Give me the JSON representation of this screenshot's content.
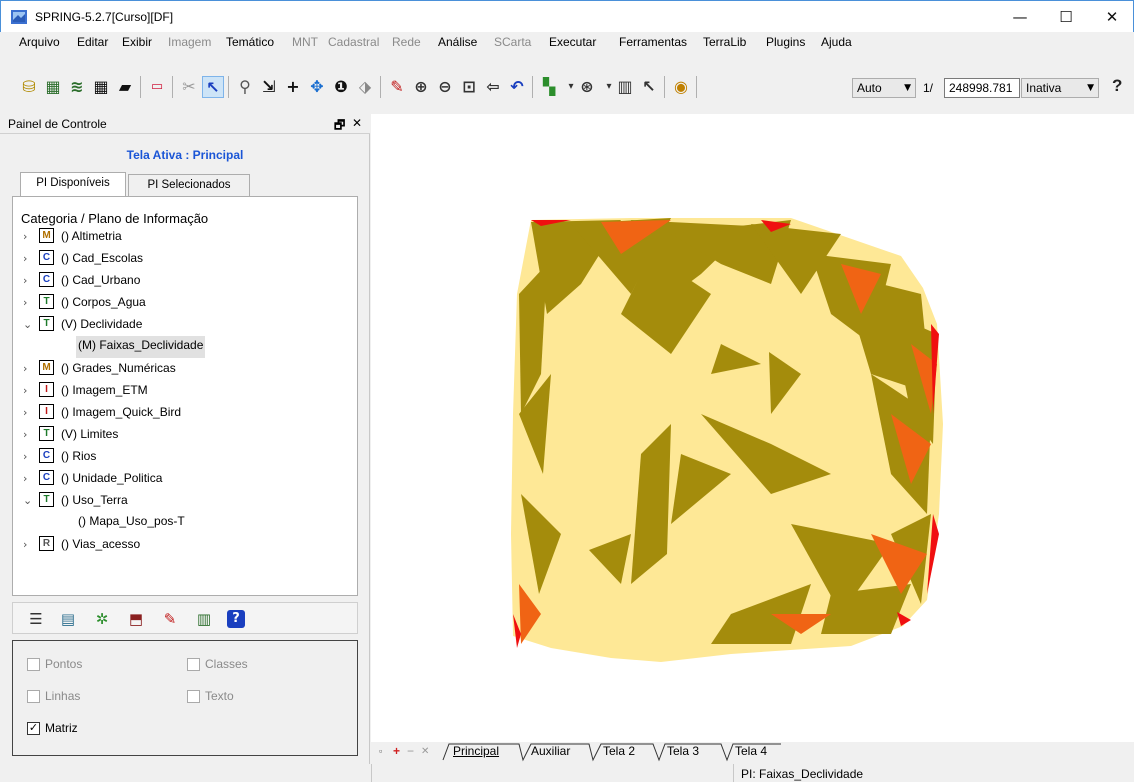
{
  "window": {
    "title": "SPRING-5.2.7[Curso][DF]",
    "minimize": "—",
    "maximize": "☐",
    "close": "✕"
  },
  "menu": [
    {
      "label": "Arquivo",
      "enabled": true
    },
    {
      "label": "Editar",
      "enabled": true
    },
    {
      "label": "Exibir",
      "enabled": true
    },
    {
      "label": "Imagem",
      "enabled": false
    },
    {
      "label": "Temático",
      "enabled": true
    },
    {
      "label": "MNT",
      "enabled": false
    },
    {
      "label": "Cadastral",
      "enabled": false
    },
    {
      "label": "Rede",
      "enabled": false
    },
    {
      "label": "Análise",
      "enabled": true
    },
    {
      "label": "SCarta",
      "enabled": false
    },
    {
      "label": "Executar",
      "enabled": true
    },
    {
      "label": "Ferramentas",
      "enabled": true
    },
    {
      "label": "TerraLib",
      "enabled": true
    },
    {
      "label": "Plugins",
      "enabled": true
    },
    {
      "label": "Ajuda",
      "enabled": true
    }
  ],
  "toolbar": {
    "zoom_mode": "Auto",
    "scale_prefix": "1/",
    "scale_value": "248998.781",
    "status_select": "Inativa",
    "help": "?"
  },
  "panel": {
    "title": "Painel de Controle",
    "float_icon": "🗗",
    "close_icon": "✕",
    "active_screen": "Tela Ativa : Principal",
    "tabs": [
      "PI Disponíveis",
      "PI Selecionados"
    ],
    "tree_header": "Categoria / Plano de Informação",
    "categories": [
      {
        "type": "M",
        "label": "() Altimetria",
        "expanded": false,
        "color": "#b07000"
      },
      {
        "type": "C",
        "label": "() Cad_Escolas",
        "expanded": false,
        "color": "#1a3fbf"
      },
      {
        "type": "C",
        "label": "() Cad_Urbano",
        "expanded": false,
        "color": "#1a3fbf"
      },
      {
        "type": "T",
        "label": "() Corpos_Agua",
        "expanded": false,
        "color": "#1d7a2a"
      },
      {
        "type": "T",
        "label": "(V) Declividade",
        "expanded": true,
        "color": "#1d7a2a",
        "children": [
          "(M) Faixas_Declividade"
        ]
      },
      {
        "type": "M",
        "label": "() Grades_Numéricas",
        "expanded": false,
        "color": "#b07000"
      },
      {
        "type": "I",
        "label": "() Imagem_ETM",
        "expanded": false,
        "color": "#c01818"
      },
      {
        "type": "I",
        "label": "() Imagem_Quick_Bird",
        "expanded": false,
        "color": "#c01818"
      },
      {
        "type": "T",
        "label": "(V) Limites",
        "expanded": false,
        "color": "#1d7a2a"
      },
      {
        "type": "C",
        "label": "() Rios",
        "expanded": false,
        "color": "#1a3fbf"
      },
      {
        "type": "C",
        "label": "() Unidade_Politica",
        "expanded": false,
        "color": "#1a3fbf"
      },
      {
        "type": "T",
        "label": "() Uso_Terra",
        "expanded": true,
        "color": "#1d7a2a",
        "children": [
          "() Mapa_Uso_pos-T"
        ]
      },
      {
        "type": "R",
        "label": "() Vias_acesso",
        "expanded": false,
        "color": "#555555"
      }
    ],
    "options": [
      {
        "label": "Pontos",
        "checked": false
      },
      {
        "label": "Classes",
        "checked": false
      },
      {
        "label": "Linhas",
        "checked": false
      },
      {
        "label": "Texto",
        "checked": false
      },
      {
        "label": "Matriz",
        "checked": true
      }
    ]
  },
  "screen_tabs": [
    "Principal",
    "Auxiliar",
    "Tela 2",
    "Tela 3",
    "Tela 4"
  ],
  "status": {
    "pi": "PI: Faixas_Declividade"
  },
  "map_colors": {
    "light": "#fee896",
    "olive": "#a48c0c",
    "orange": "#f06414",
    "red": "#f01010"
  }
}
